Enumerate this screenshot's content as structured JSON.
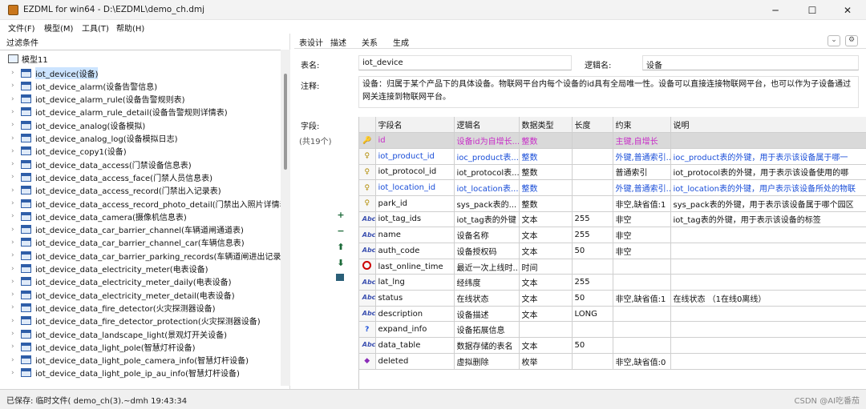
{
  "window": {
    "title": "EZDML for win64 - D:\\EZDML\\demo_ch.dmj",
    "minimize": "─",
    "maximize": "☐",
    "close": "✕"
  },
  "menu": [
    "文件(F)",
    "模型(M)",
    "工具(T)",
    "帮助(H)"
  ],
  "left": {
    "filter_label": "过滤条件",
    "root": "模型11",
    "tables": [
      "iot_device(设备)",
      "iot_device_alarm(设备告警信息)",
      "iot_device_alarm_rule(设备告警规则表)",
      "iot_device_alarm_rule_detail(设备告警规则详情表)",
      "iot_device_analog(设备模拟)",
      "iot_device_analog_log(设备模拟日志)",
      "iot_device_copy1(设备)",
      "iot_device_data_access(门禁设备信息表)",
      "iot_device_data_access_face(门禁人员信息表)",
      "iot_device_data_access_record(门禁出入记录表)",
      "iot_device_data_access_record_photo_detail(门禁出入照片详情表)",
      "iot_device_data_camera(摄像机信息表)",
      "iot_device_data_car_barrier_channel(车辆道闸通道表)",
      "iot_device_data_car_barrier_channel_car(车辆信息表)",
      "iot_device_data_car_barrier_parking_records(车辆道闸进出记录表",
      "iot_device_data_electricity_meter(电表设备)",
      "iot_device_data_electricity_meter_daily(电表设备)",
      "iot_device_data_electricity_meter_detail(电表设备)",
      "iot_device_data_fire_detector(火灾探测器设备)",
      "iot_device_data_fire_detector_protection(火灾探测器设备)",
      "iot_device_data_landscape_light(景观灯开关设备)",
      "iot_device_data_light_pole(智慧灯杆设备)",
      "iot_device_data_light_pole_camera_info(智慧灯杆设备)",
      "iot_device_data_light_pole_ip_au_info(智慧灯杆设备)"
    ]
  },
  "right": {
    "tabs": [
      "表设计",
      "描述",
      "关系",
      "生成"
    ],
    "table_name_label": "表名:",
    "table_name": "iot_device",
    "logic_name_label": "逻辑名:",
    "logic_name": "设备",
    "comment_label": "注释:",
    "comment": "设备：归属于某个产品下的具体设备。物联网平台内每个设备的id具有全局唯一性。设备可以直接连接物联网平台，也可以作为子设备通过网关连接到物联网平台。",
    "fields_label": "字段:",
    "fields_count": "(共19个)",
    "columns": [
      "字段名",
      "逻辑名",
      "数据类型",
      "长度",
      "约束",
      "说明"
    ],
    "rows": [
      {
        "icon": "key-icon",
        "kind": "pk",
        "cells": [
          "id",
          "设备id为自增长...",
          "整数",
          "",
          "主键,自增长",
          ""
        ]
      },
      {
        "icon": "fk-key-icon",
        "kind": "fk",
        "cells": [
          "iot_product_id",
          "ioc_product表...",
          "整数",
          "",
          "外键,普通索引...",
          "ioc_product表的外键，用于表示该设备属于哪一"
        ]
      },
      {
        "icon": "fk-key-icon",
        "kind": "",
        "cells": [
          "iot_protocol_id",
          "iot_protocol表...",
          "整数",
          "",
          "普通索引",
          "iot_protocol表的外键，用于表示该设备使用的哪"
        ]
      },
      {
        "icon": "fk-key-icon",
        "kind": "fk",
        "cells": [
          "iot_location_id",
          "iot_location表...",
          "整数",
          "",
          "外键,普通索引...",
          "iot_location表的外键，用户表示该设备所处的物联"
        ]
      },
      {
        "icon": "fk-key-icon",
        "kind": "",
        "cells": [
          "park_id",
          "sys_pack表的...",
          "整数",
          "",
          "非空,缺省值:1",
          "sys_pack表的外键，用于表示该设备属于哪个园区"
        ]
      },
      {
        "icon": "text-icon",
        "kind": "",
        "cells": [
          "iot_tag_ids",
          "iot_tag表的外键",
          "文本",
          "255",
          "非空",
          "iot_tag表的外键，用于表示该设备的标签"
        ]
      },
      {
        "icon": "text-icon",
        "kind": "",
        "cells": [
          "name",
          "设备名称",
          "文本",
          "255",
          "非空",
          ""
        ]
      },
      {
        "icon": "text-icon",
        "kind": "",
        "cells": [
          "auth_code",
          "设备授权码",
          "文本",
          "50",
          "非空",
          ""
        ]
      },
      {
        "icon": "clock-icon",
        "kind": "",
        "cells": [
          "last_online_time",
          "最近一次上线时...",
          "时间",
          "",
          "",
          ""
        ]
      },
      {
        "icon": "text-icon",
        "kind": "",
        "cells": [
          "lat_lng",
          "经纬度",
          "文本",
          "255",
          "",
          ""
        ]
      },
      {
        "icon": "text-icon",
        "kind": "",
        "cells": [
          "status",
          "在线状态",
          "文本",
          "50",
          "非空,缺省值:1",
          "在线状态 （1在线0离线）"
        ]
      },
      {
        "icon": "text-icon",
        "kind": "",
        "cells": [
          "description",
          "设备描述",
          "文本",
          "LONG",
          "",
          ""
        ]
      },
      {
        "icon": "question-icon",
        "kind": "",
        "cells": [
          "expand_info",
          "设备拓展信息",
          "",
          "",
          "",
          ""
        ]
      },
      {
        "icon": "text-icon",
        "kind": "",
        "cells": [
          "data_table",
          "数据存储的表名",
          "文本",
          "50",
          "",
          ""
        ]
      },
      {
        "icon": "enum-icon",
        "kind": "",
        "cells": [
          "deleted",
          "虚拟删除",
          "枚举",
          "",
          "非空,缺省值:0",
          ""
        ]
      }
    ]
  },
  "status": {
    "text": "已保存: 临时文件( demo_ch(3).~dmh 19:43:34",
    "watermark": "CSDN @AI吃番茄"
  }
}
